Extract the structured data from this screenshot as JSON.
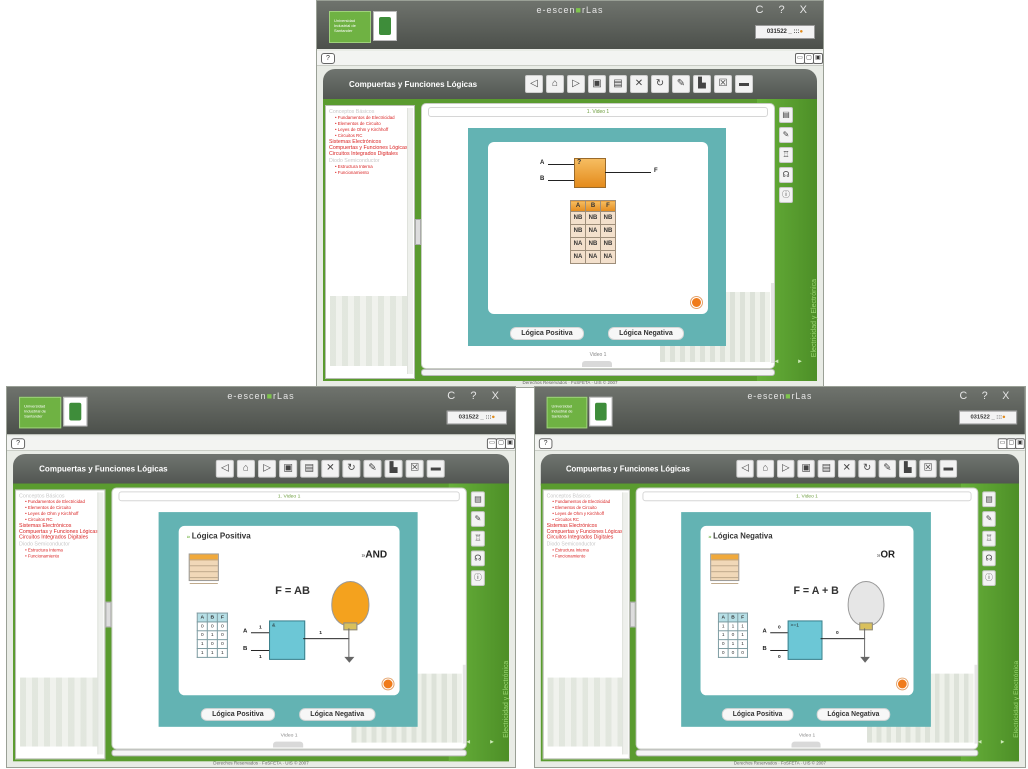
{
  "app": {
    "brand_pre": "e-escen",
    "brand_post": "rLas",
    "logo_text": "Universidad Industrial de Santander",
    "window_controls": "C ? X",
    "counter": "031522 _ :::",
    "counter_badge": "●",
    "help_label": "?",
    "module_title": "Compuertas y Funciones Lógicas",
    "video_label": "1. Video 1",
    "footer_label": "Video 1",
    "copyright": "Derechos Reservados · FoSFETA · UIS © 2007",
    "side_text": "Electricidad y Electrónica",
    "nav_arrows": "◄ ►"
  },
  "toolbar": {
    "icons": [
      "back-icon",
      "home-icon",
      "forward-icon",
      "print-icon",
      "calculator-icon",
      "tools-icon",
      "refresh-icon",
      "notes-icon",
      "glossary-icon",
      "bookmark-icon",
      "exit-icon"
    ],
    "glyphs": [
      "◁",
      "⌂",
      "▷",
      "▣",
      "▤",
      "✕",
      "↻",
      "✎",
      "▙",
      "☒",
      "▬"
    ]
  },
  "right_icons": {
    "icons": [
      "document-icon",
      "pencil-icon",
      "network-icon",
      "users-icon",
      "info-icon"
    ],
    "glyphs": [
      "▤",
      "✎",
      "♖",
      "☊",
      "ⓘ"
    ]
  },
  "nav": {
    "items": [
      {
        "label": "Conceptos Básicos",
        "style": "gray big"
      },
      {
        "label": "• Fundamentos de Electricidad",
        "style": "sub"
      },
      {
        "label": "• Elementos de Circuito",
        "style": "sub"
      },
      {
        "label": "• Leyes de Ohm y Kirchhoff",
        "style": "sub"
      },
      {
        "label": "• Circuitos RC",
        "style": "sub"
      },
      {
        "label": "Sistemas Electrónicos",
        "style": "big"
      },
      {
        "label": "Compuertas y Funciones Lógicas",
        "style": "big"
      },
      {
        "label": "Circuitos Integrados Digitales",
        "style": "big"
      },
      {
        "label": "Diodo Semiconductor",
        "style": "gray big"
      },
      {
        "label": "• Estructura Interna",
        "style": "sub"
      },
      {
        "label": "• Funcionamiento",
        "style": "sub"
      }
    ]
  },
  "screens": [
    {
      "id": "intro",
      "gate_label": "?",
      "inputs": [
        "A",
        "B"
      ],
      "output": "F",
      "table": {
        "headers": [
          "A",
          "B",
          "F"
        ],
        "rows": [
          [
            "NB",
            "NB",
            "NB"
          ],
          [
            "NB",
            "NA",
            "NB"
          ],
          [
            "NA",
            "NB",
            "NB"
          ],
          [
            "NA",
            "NA",
            "NA"
          ]
        ]
      },
      "btn_positive": "Lógica Positiva",
      "btn_negative": "Lógica Negativa"
    },
    {
      "id": "positive",
      "title_marker": "»",
      "title": "Lógica Positiva",
      "gate_marker": "»",
      "gate_name": "AND",
      "formula": "F = AB",
      "gate_symbol": "&",
      "inputs": [
        "A",
        "B"
      ],
      "input_values": [
        "1",
        "1"
      ],
      "output_value": "1",
      "bulb_color": "#f4a21e",
      "table": {
        "headers": [
          "A",
          "B",
          "F"
        ],
        "rows": [
          [
            "0",
            "0",
            "0"
          ],
          [
            "0",
            "1",
            "0"
          ],
          [
            "1",
            "0",
            "0"
          ],
          [
            "1",
            "1",
            "1"
          ]
        ]
      },
      "btn_positive": "Lógica Positiva",
      "btn_negative": "Lógica Negativa"
    },
    {
      "id": "negative",
      "title_marker": "»",
      "title": "Lógica Negativa",
      "gate_marker": "»",
      "gate_name": "OR",
      "formula": "F = A + B",
      "gate_symbol": ">=1",
      "inputs": [
        "A",
        "B"
      ],
      "input_values": [
        "0",
        "0"
      ],
      "output_value": "0",
      "bulb_color": "#e6e6e6",
      "table": {
        "headers": [
          "A",
          "B",
          "F"
        ],
        "rows": [
          [
            "1",
            "1",
            "1"
          ],
          [
            "1",
            "0",
            "1"
          ],
          [
            "0",
            "1",
            "1"
          ],
          [
            "0",
            "0",
            "0"
          ]
        ]
      },
      "btn_positive": "Lógica Positiva",
      "btn_negative": "Lógica Negativa"
    }
  ],
  "colors": {
    "accent_green": "#5a9b2f",
    "teal_panel": "#63b3b3",
    "orange": "#f07b1a",
    "nav_red": "#d81f1f"
  }
}
